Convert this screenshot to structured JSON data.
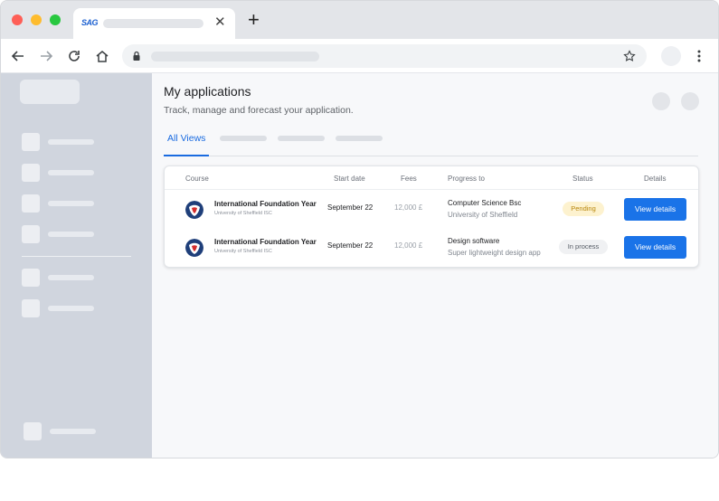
{
  "browser": {
    "tab_favicon_text": "SAG",
    "close_glyph": "✕",
    "new_tab_glyph": "+",
    "icons": [
      "back-arrow-icon",
      "forward-arrow-icon",
      "reload-icon",
      "home-icon",
      "lock-icon",
      "star-icon",
      "kebab-menu-icon"
    ]
  },
  "page": {
    "title": "My applications",
    "subtitle": "Track, manage and forecast your application."
  },
  "tabs": {
    "active_label": "All Views"
  },
  "table": {
    "headers": {
      "course": "Course",
      "start": "Start date",
      "fees": "Fees",
      "progress": "Progress to",
      "status": "Status",
      "details": "Details"
    },
    "rows": [
      {
        "course": "International Foundation Year",
        "university": "University of Sheffield ISC",
        "start": "September 22",
        "fees": "12,000 £",
        "progress_title": "Computer Science Bsc",
        "progress_sub": "University of Sheffield",
        "status": "Pending",
        "action": "View details"
      },
      {
        "course": "International Foundation Year",
        "university": "University of Sheffield ISC",
        "start": "September 22",
        "fees": "12,000 £",
        "progress_title": "Design software",
        "progress_sub": "Super lightweight design app",
        "status": "In process",
        "action": "View details"
      }
    ]
  },
  "colors": {
    "accent": "#1a73e8",
    "pending_bg": "#fdf2cf",
    "pending_text": "#b8860b",
    "sidebar_bg": "#d0d5de"
  }
}
